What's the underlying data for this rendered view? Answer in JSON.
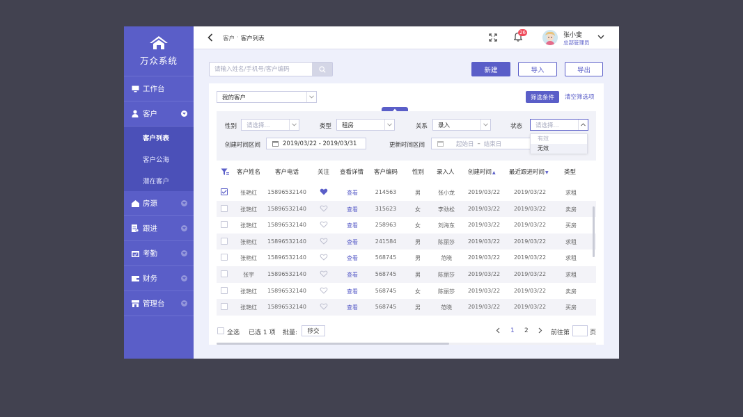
{
  "app_title": "万众系统",
  "sidebar": {
    "items": [
      {
        "label": "工作台",
        "icon": "monitor-icon"
      },
      {
        "label": "客户",
        "icon": "user-icon",
        "expanded": true,
        "children": [
          {
            "label": "客户列表",
            "active": true
          },
          {
            "label": "客户公海"
          },
          {
            "label": "潜在客户"
          }
        ]
      },
      {
        "label": "房源",
        "icon": "house-icon"
      },
      {
        "label": "跟进",
        "icon": "document-icon"
      },
      {
        "label": "考勤",
        "icon": "calendar-icon"
      },
      {
        "label": "财务",
        "icon": "wallet-icon"
      },
      {
        "label": "管理台",
        "icon": "store-icon"
      }
    ]
  },
  "header": {
    "breadcrumb": [
      "客户",
      "客户列表"
    ],
    "notification_count": "26",
    "user": {
      "name": "张小斐",
      "role": "总部管理员"
    }
  },
  "search": {
    "placeholder": "请输入姓名/手机号/客户编码"
  },
  "toolbar": {
    "new_label": "新建",
    "import_label": "导入",
    "export_label": "导出"
  },
  "filter_bar": {
    "scope_value": "我的客户",
    "filter_btn": "筛选条件",
    "clear_link": "清空筛选项"
  },
  "filters": {
    "gender": {
      "label": "性别",
      "placeholder": "请选择..."
    },
    "type": {
      "label": "类型",
      "value": "租房"
    },
    "relation": {
      "label": "关系",
      "value": "录入"
    },
    "status": {
      "label": "状态",
      "placeholder": "请选择...",
      "options": [
        "有效",
        "无效"
      ]
    },
    "created": {
      "label": "创建时间区间",
      "value": "2019/03/22 - 2019/03/31"
    },
    "updated": {
      "label": "更新时间区间",
      "start_placeholder": "起始日",
      "separator": "–",
      "end_placeholder": "结束日"
    }
  },
  "table": {
    "columns": [
      "客户姓名",
      "客户电话",
      "关注",
      "查看详情",
      "客户编码",
      "性别",
      "录入人",
      "创建时间",
      "最近跟进时间",
      "类型"
    ],
    "view_label": "查看",
    "rows": [
      {
        "name": "张艳红",
        "phone": "15896532140",
        "followed": true,
        "code": "214563",
        "gender": "男",
        "creator": "张小龙",
        "created": "2019/03/22",
        "last_follow": "2019/03/22",
        "type": "求租",
        "checked": true
      },
      {
        "name": "张艳红",
        "phone": "15896532140",
        "followed": false,
        "code": "315623",
        "gender": "女",
        "creator": "李劲松",
        "created": "2019/03/22",
        "last_follow": "2019/03/22",
        "type": "卖房",
        "checked": false
      },
      {
        "name": "张艳红",
        "phone": "15896532140",
        "followed": false,
        "code": "258963",
        "gender": "女",
        "creator": "刘海东",
        "created": "2019/03/22",
        "last_follow": "2019/03/22",
        "type": "买房",
        "checked": false
      },
      {
        "name": "张艳红",
        "phone": "15896532140",
        "followed": false,
        "code": "241584",
        "gender": "男",
        "creator": "陈丽莎",
        "created": "2019/03/22",
        "last_follow": "2019/03/22",
        "type": "求租",
        "checked": false
      },
      {
        "name": "张艳红",
        "phone": "15896532140",
        "followed": false,
        "code": "568745",
        "gender": "男",
        "creator": "范晓",
        "created": "2019/03/22",
        "last_follow": "2019/03/22",
        "type": "求租",
        "checked": false
      },
      {
        "name": "张宇",
        "phone": "15896532140",
        "followed": false,
        "code": "568745",
        "gender": "男",
        "creator": "陈丽莎",
        "created": "2019/03/22",
        "last_follow": "2019/03/22",
        "type": "求租",
        "checked": false
      },
      {
        "name": "张艳红",
        "phone": "15896532140",
        "followed": false,
        "code": "568745",
        "gender": "女",
        "creator": "陈丽莎",
        "created": "2019/03/22",
        "last_follow": "2019/03/22",
        "type": "卖房",
        "checked": false
      },
      {
        "name": "张艳红",
        "phone": "15896532140",
        "followed": false,
        "code": "568745",
        "gender": "男",
        "creator": "范晓",
        "created": "2019/03/22",
        "last_follow": "2019/03/22",
        "type": "买房",
        "checked": false
      }
    ]
  },
  "footer": {
    "select_all": "全选",
    "selected_text": "已选 1 项",
    "batch_label": "批量:",
    "move_label": "移交",
    "pages": [
      "1",
      "2"
    ],
    "current_page": "1",
    "goto_label": "前往第",
    "page_suffix": "页"
  },
  "colors": {
    "primary": "#5a5ec8",
    "sidebar": "#5a5ec8",
    "badge": "#f04a5a"
  }
}
